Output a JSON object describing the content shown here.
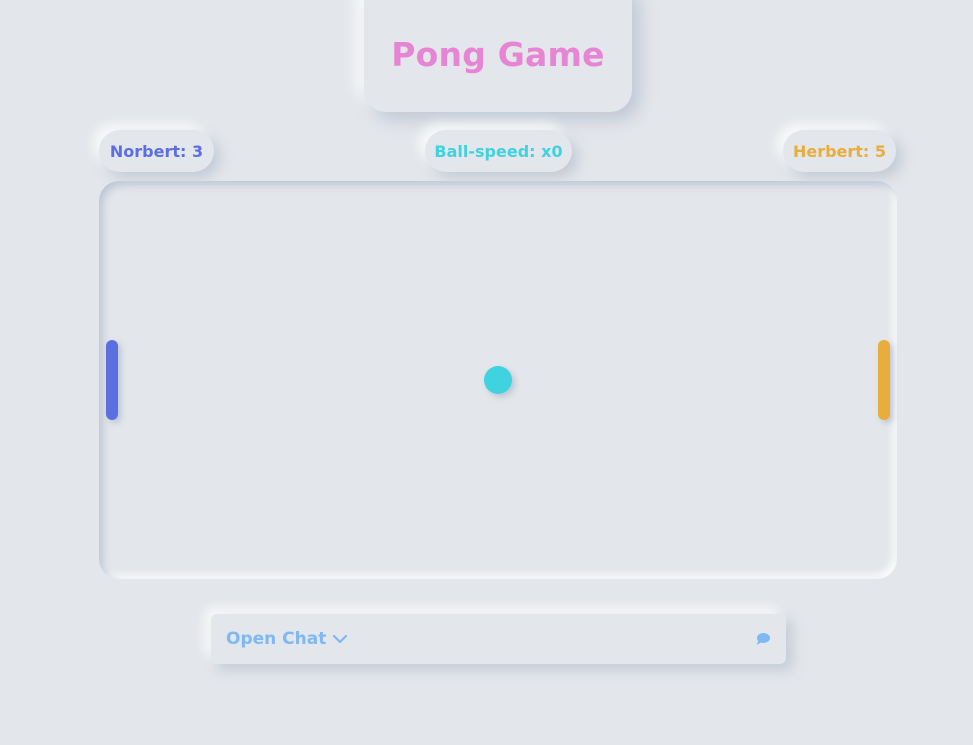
{
  "title": "Pong Game",
  "scores": {
    "left": "Norbert: 3",
    "speed": "Ball-speed: x0",
    "right": "Herbert: 5"
  },
  "colors": {
    "title": "#e785d4",
    "player_left": "#5b6fe0",
    "ball": "#3fd3df",
    "player_right": "#e9ad3b",
    "chat": "#7fb8f2",
    "background": "#e3e6ea"
  },
  "chat": {
    "label": "Open Chat",
    "toggle_icon": "chevron-down-icon",
    "chat_icon": "chat-bubble-icon"
  }
}
